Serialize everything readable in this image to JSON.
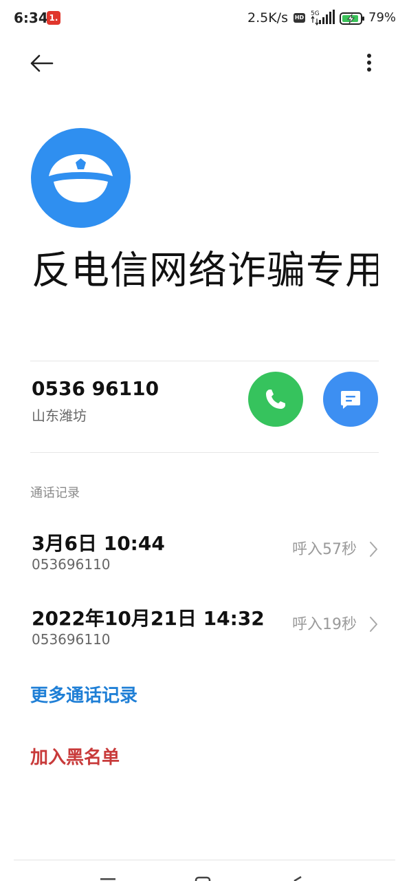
{
  "status_bar": {
    "time": "6:34",
    "notification_badge": "1.",
    "network_speed": "2.5K/s",
    "hd_label": "HD",
    "network_type": "5G",
    "battery_percent": "79%",
    "icon_signal": "signal-icon",
    "icon_battery": "battery-charging-icon"
  },
  "top_bar": {
    "back_icon": "back-arrow-icon",
    "more_icon": "more-vertical-icon"
  },
  "contact": {
    "avatar_icon": "police-cap-icon",
    "avatar_color": "#2f8ff0",
    "name": "反电信网络诈骗专用"
  },
  "phone": {
    "number": "0536 96110",
    "location": "山东潍坊",
    "call_icon": "phone-icon",
    "call_color": "#36c35d",
    "message_icon": "message-icon",
    "message_color": "#3d8ff2"
  },
  "call_log": {
    "title": "通话记录",
    "entries": [
      {
        "date": "3月6日 10:44",
        "number": "053696110",
        "info": "呼入57秒"
      },
      {
        "date": "2022年10月21日 14:32",
        "number": "053696110",
        "info": "呼入19秒"
      }
    ],
    "more_label": "更多通话记录"
  },
  "actions": {
    "block_label": "加入黑名单",
    "block_color": "#c83a3a",
    "link_color": "#1f7fd6"
  }
}
